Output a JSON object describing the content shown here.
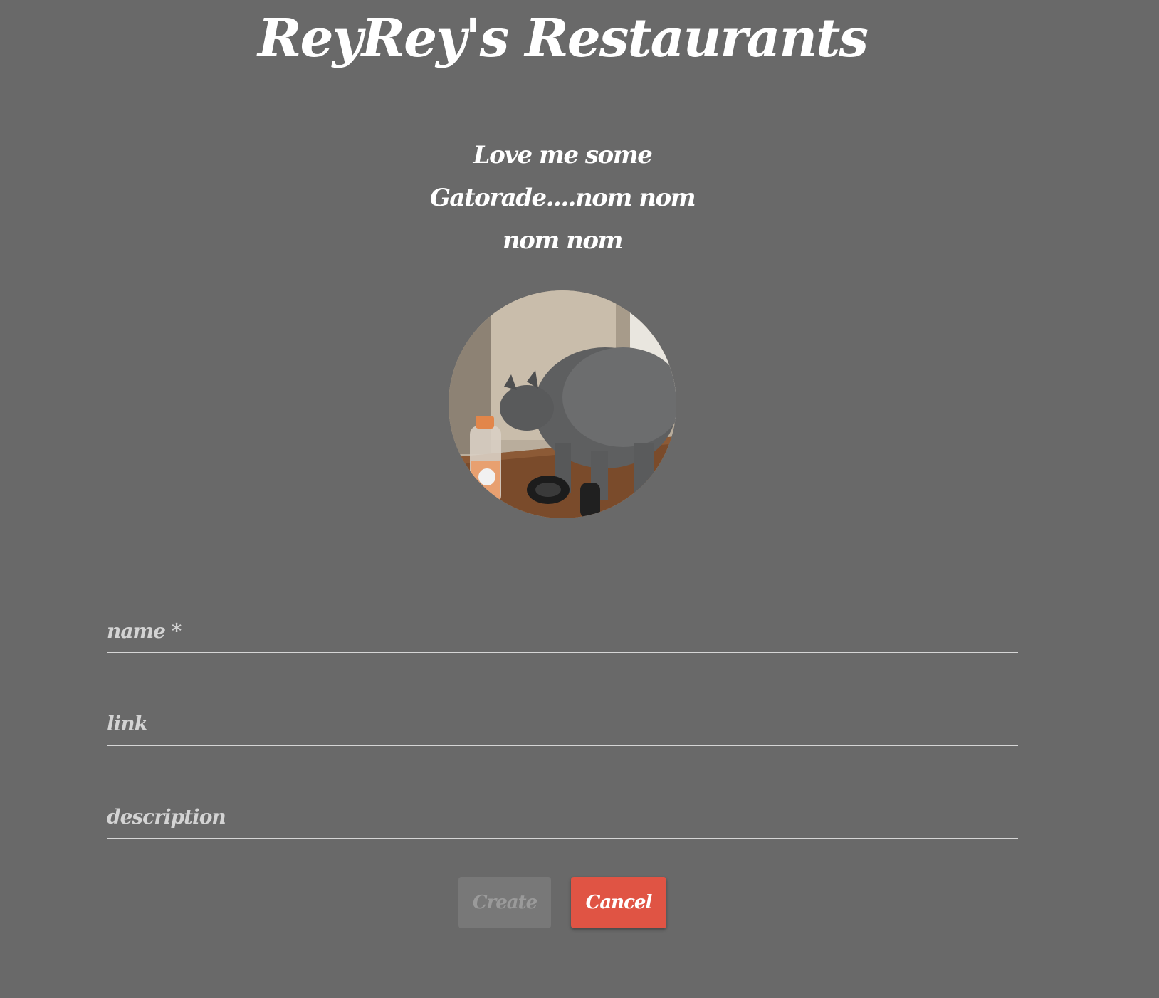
{
  "header": {
    "title": "ReyRey's Restaurants"
  },
  "intro": {
    "tagline": "Love me some Gatorade....nom nom nom nom",
    "avatar_icon": "cat-with-gatorade-photo"
  },
  "form": {
    "name_placeholder": "name *",
    "link_placeholder": "link",
    "description_placeholder": "description",
    "name_value": "",
    "link_value": "",
    "description_value": ""
  },
  "actions": {
    "create_label": "Create",
    "cancel_label": "Cancel",
    "create_enabled": false
  },
  "colors": {
    "background": "#696969",
    "cancel_button": "#e05444",
    "create_button_disabled": "#787878",
    "underline": "#d6d6d6"
  }
}
